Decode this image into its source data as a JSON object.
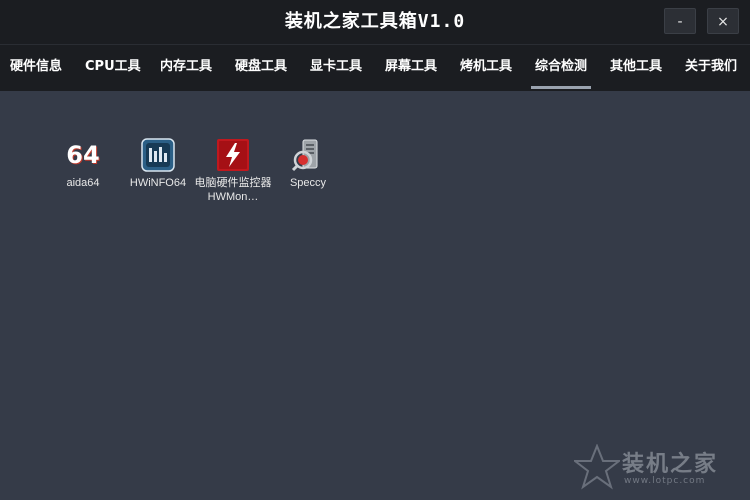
{
  "window": {
    "title": "装机之家工具箱V1.0",
    "minimize_glyph": "-",
    "close_glyph": "×"
  },
  "tabs": [
    {
      "label": "硬件信息",
      "active": false
    },
    {
      "label": "CPU工具",
      "active": false
    },
    {
      "label": "内存工具",
      "active": false
    },
    {
      "label": "硬盘工具",
      "active": false
    },
    {
      "label": "显卡工具",
      "active": false
    },
    {
      "label": "屏幕工具",
      "active": false
    },
    {
      "label": "烤机工具",
      "active": false
    },
    {
      "label": "综合检测",
      "active": true
    },
    {
      "label": "其他工具",
      "active": false
    },
    {
      "label": "关于我们",
      "active": false
    }
  ],
  "tools": [
    {
      "label": "aida64",
      "icon": "aida64-icon",
      "icon_text": "64"
    },
    {
      "label": "HWiNFO64",
      "icon": "hwinfo-icon"
    },
    {
      "label": "电脑硬件监控器HWMon…",
      "icon": "hwmonitor-icon"
    },
    {
      "label": "Speccy",
      "icon": "speccy-icon"
    }
  ],
  "watermark": {
    "text": "装机之家",
    "url": "www.lotpc.com"
  },
  "colors": {
    "background": "#353b48",
    "titlebar": "#1b1d21",
    "active_underline": "#9aa3af"
  }
}
